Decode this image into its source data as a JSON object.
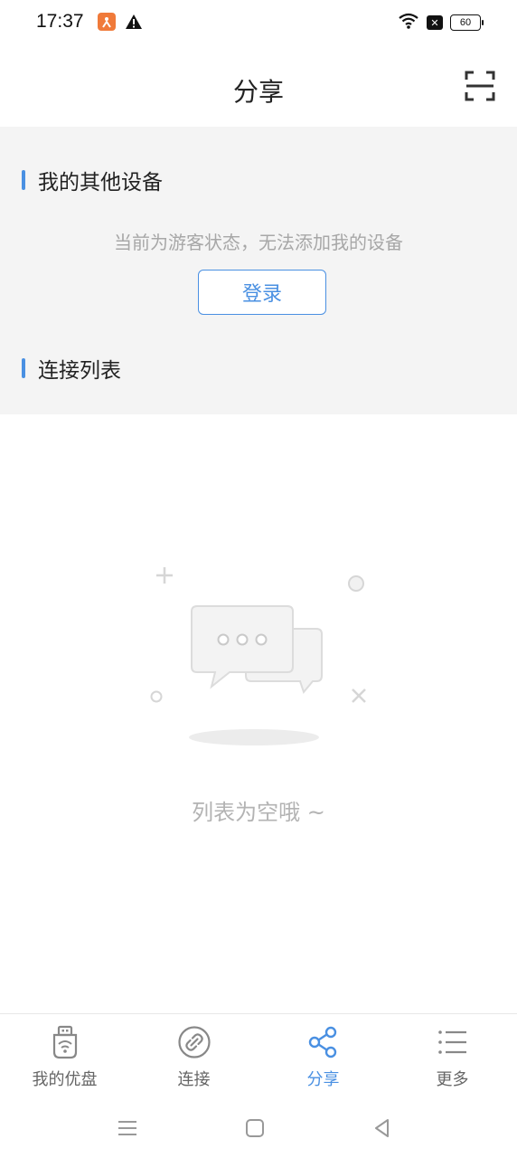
{
  "status_bar": {
    "time": "17:37",
    "battery": "60",
    "icons": [
      "app-notification-icon",
      "warning-icon",
      "wifi-icon",
      "sim-disabled-icon",
      "battery-icon"
    ]
  },
  "header": {
    "title": "分享",
    "scan_icon": "scan-icon"
  },
  "devices_section": {
    "title": "我的其他设备",
    "guest_hint": "当前为游客状态，无法添加我的设备",
    "login_label": "登录"
  },
  "connections_section": {
    "title": "连接列表",
    "empty_text": "列表为空哦 ~"
  },
  "bottom_nav": {
    "items": [
      {
        "label": "我的优盘",
        "icon": "usb-drive-icon",
        "active": false
      },
      {
        "label": "连接",
        "icon": "link-icon",
        "active": false
      },
      {
        "label": "分享",
        "icon": "share-icon",
        "active": true
      },
      {
        "label": "更多",
        "icon": "list-icon",
        "active": false
      }
    ]
  },
  "colors": {
    "accent": "#4a90e2",
    "section_bg": "#f4f4f4",
    "hint_text": "#a7a7a7"
  }
}
